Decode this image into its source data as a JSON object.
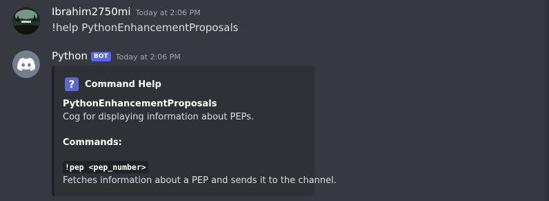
{
  "messages": [
    {
      "username": "Ibrahim2750mi",
      "timestamp": "Today at 2:06 PM",
      "content": "!help PythonEnhancementProposals",
      "avatar_icon": "user-avatar-landscape-icon"
    },
    {
      "username": "Python",
      "bot_tag": "BOT",
      "timestamp": "Today at 2:06 PM",
      "avatar_icon": "discord-logo-icon",
      "embed": {
        "author_icon": "question-mark-icon",
        "author_icon_glyph": "?",
        "author_name": "Command Help",
        "cog_name": "PythonEnhancementProposals",
        "cog_description": "Cog for displaying information about PEPs.",
        "commands_header": "Commands:",
        "command_usage": "!pep <pep_number>",
        "command_description": "Fetches information about a PEP and sends it to the channel.",
        "border_color": "#202225"
      }
    }
  ],
  "colors": {
    "background": "#36393f",
    "embed_background": "#2f3136",
    "bot_tag": "#5865f2",
    "timestamp": "#a3a6aa",
    "text": "#dcddde"
  }
}
